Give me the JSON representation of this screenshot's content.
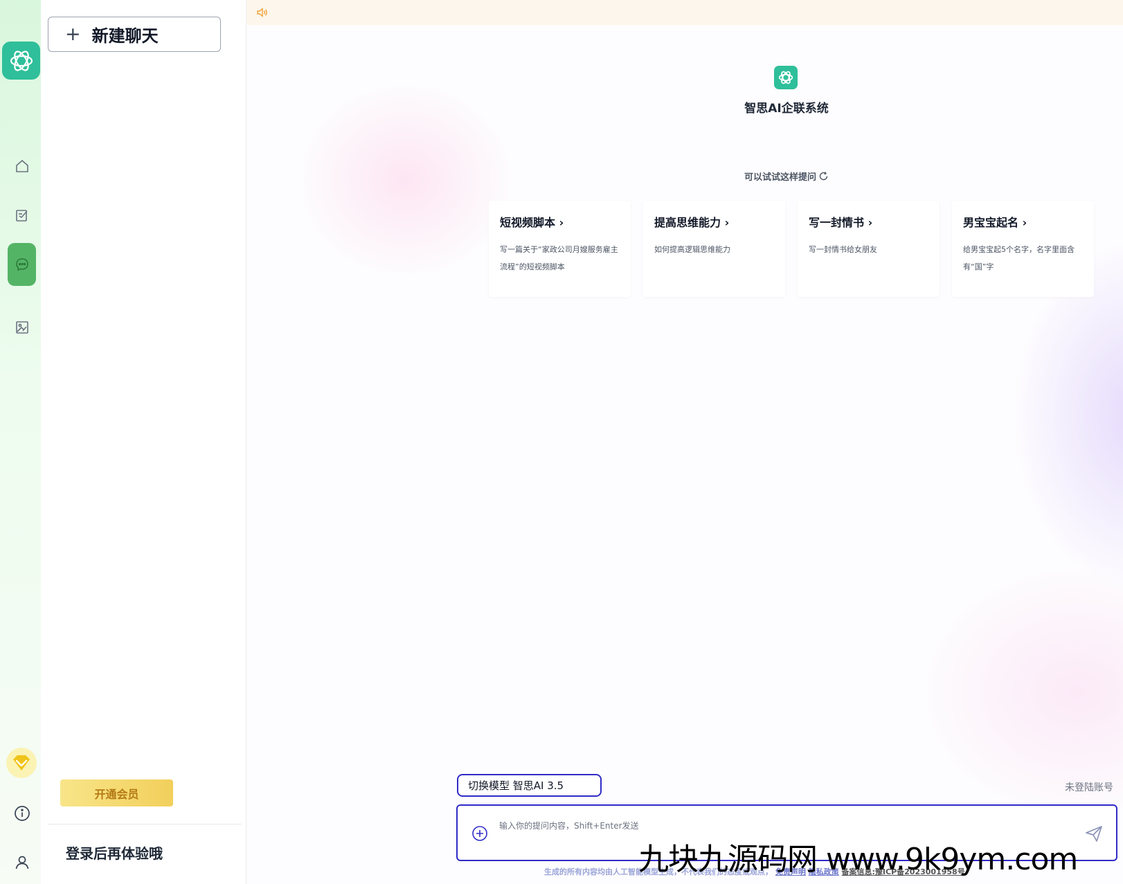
{
  "rail": {
    "logo_icon": "openai-knot-icon",
    "items": [
      {
        "icon": "home-icon"
      },
      {
        "icon": "edit-doc-icon"
      },
      {
        "icon": "chat-bubble-icon",
        "active": true
      },
      {
        "icon": "image-edit-icon"
      }
    ],
    "bottom": [
      {
        "icon": "vip-diamond-icon"
      },
      {
        "icon": "info-icon"
      },
      {
        "icon": "user-icon"
      }
    ]
  },
  "sidebar": {
    "new_chat_label": "新建聊天",
    "vip_label": "开通会员",
    "login_tip": "登录后再体验哦"
  },
  "main": {
    "brand_name": "智思AI企联系统",
    "suggest_title": "可以试试这样提问",
    "cards": [
      {
        "title": "短视频脚本",
        "desc": "写一篇关于“家政公司月嫂服务雇主流程”的短视频脚本"
      },
      {
        "title": "提高思维能力",
        "desc": "如何提高逻辑思维能力"
      },
      {
        "title": "写一封情书",
        "desc": "写一封情书给女朋友"
      },
      {
        "title": "男宝宝起名",
        "desc": "给男宝宝起5个名字，名字里面含有“国”字"
      }
    ],
    "model_switch": "切换模型 智思AI 3.5",
    "user_status": "未登陆账号",
    "input_placeholder": "输入你的提问内容，Shift+Enter发送",
    "footer_text": "生成的所有内容均由人工智能模型生成，不代表我们的态度或观点，",
    "footer_link1": "免责声明",
    "footer_link2": "隐私政策",
    "footer_icp": "备案信息:豫ICP备2023001958号",
    "watermark": "九块九源码网 www.9k9ym.com"
  },
  "colors": {
    "brand_green": "#2fbf9a",
    "active_green": "#54b466",
    "accent_blue": "#2f2bc6",
    "vip_gold": "#f2cf5b"
  }
}
